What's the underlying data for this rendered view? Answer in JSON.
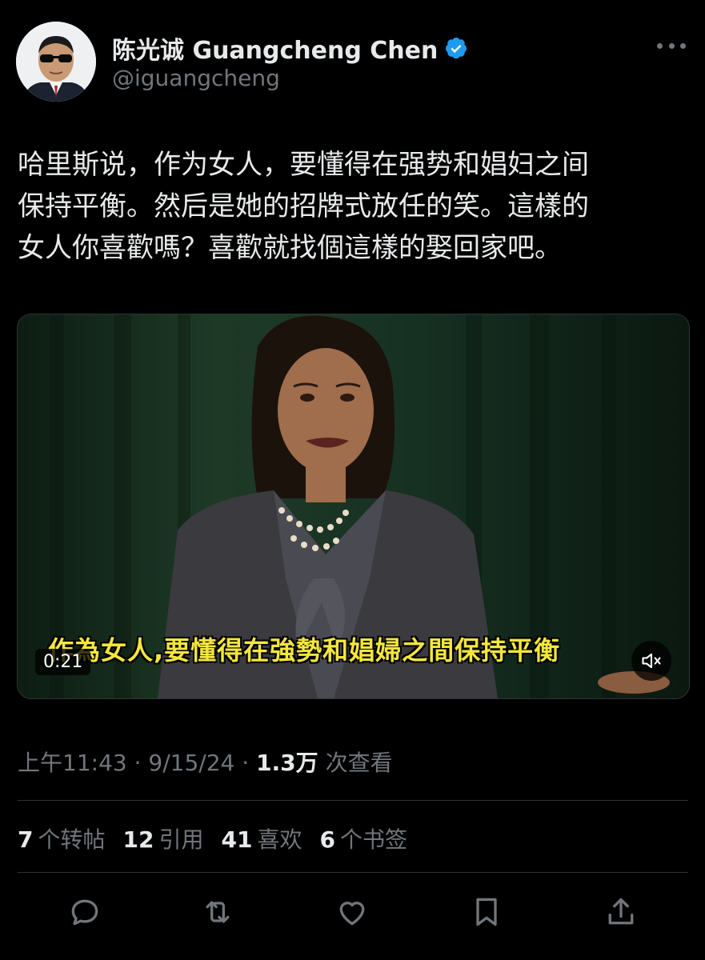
{
  "author": {
    "display_name": "陈光诚 Guangcheng Chen",
    "handle": "@iguangcheng",
    "verified": true,
    "verified_color": "#1d9bf0",
    "avatar_icon": "avatar-man-sunglasses"
  },
  "more_icon": "more-horizontal-icon",
  "tweet": {
    "text": "哈里斯说，作为女人，要懂得在强势和娼妇之间\n保持平衡。然后是她的招牌式放任的笑。這樣的\n女人你喜歡嗎？喜歡就找個這樣的娶回家吧。"
  },
  "video": {
    "subtitle": "作為女人,要懂得在強勢和娼婦之間保持平衡",
    "duration": "0:21",
    "mute_icon": "volume-muted-icon",
    "subtitle_color": "#f4e63c"
  },
  "meta": {
    "time": "上午11:43",
    "sep1": " · ",
    "date": "9/15/24",
    "sep2": " · ",
    "views_count": "1.3万",
    "views_label": " 次查看"
  },
  "stats": [
    {
      "count": "7",
      "label": "个转帖"
    },
    {
      "count": "12",
      "label": "引用"
    },
    {
      "count": "41",
      "label": "喜欢"
    },
    {
      "count": "6",
      "label": "个书签"
    }
  ],
  "actions": [
    {
      "icon": "reply-icon"
    },
    {
      "icon": "retweet-icon"
    },
    {
      "icon": "like-icon"
    },
    {
      "icon": "bookmark-icon"
    },
    {
      "icon": "share-icon"
    }
  ],
  "colors": {
    "background": "#000000",
    "text": "#e7e9ea",
    "secondary": "#71767b",
    "divider": "#2f3336"
  }
}
